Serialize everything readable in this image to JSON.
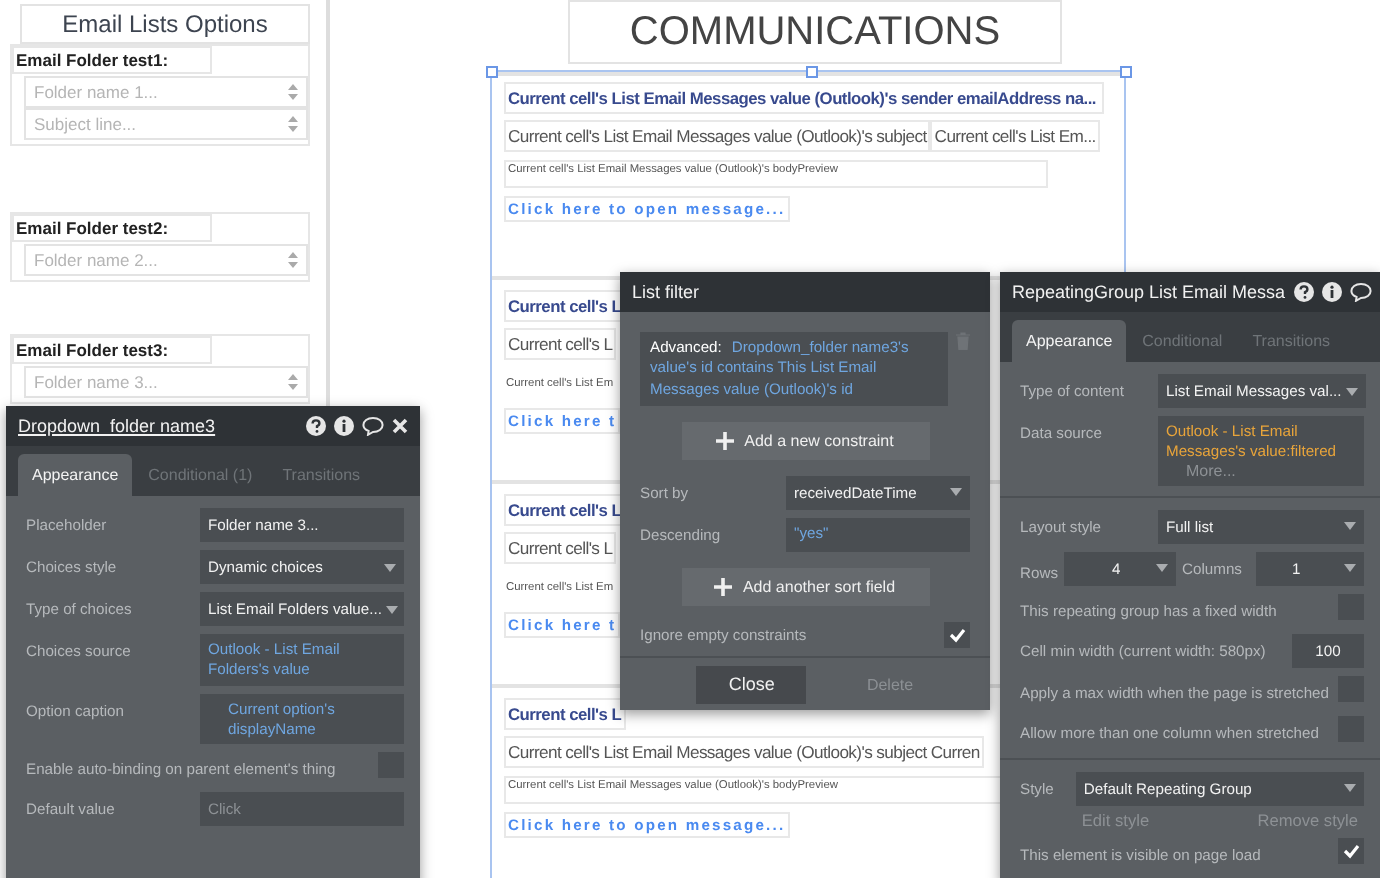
{
  "left_panel": {
    "title": "Email Lists Options",
    "groups": [
      {
        "label": "Email Folder test1:",
        "dropdowns": [
          {
            "placeholder": "Folder name 1..."
          },
          {
            "placeholder": "Subject line..."
          }
        ]
      },
      {
        "label": "Email Folder test2:",
        "dropdowns": [
          {
            "placeholder": "Folder name 2..."
          }
        ]
      },
      {
        "label": "Email Folder test3:",
        "dropdowns": [
          {
            "placeholder": "Folder name 3..."
          }
        ]
      }
    ]
  },
  "canvas": {
    "heading": "COMMUNICATIONS",
    "cells": [
      {
        "sender": "Current cell's List Email Messages value (Outlook)'s sender emailAddress na...",
        "subject": "Current cell's List Email Messages value (Outlook)'s subject",
        "subject_2": "Current cell's List Em...",
        "body_preview": "Current cell's List Email Messages value (Outlook)'s bodyPreview",
        "link": "Click here to open message..."
      },
      {
        "sender": "Current cell's L",
        "subject": "Current cell's L",
        "body_preview": "Current cell's List Em",
        "link": "Click here t"
      },
      {
        "sender": "Current cell's L",
        "subject": "Current cell's L",
        "body_preview": "Current cell's List Em",
        "link": "Click here t"
      },
      {
        "sender": "Current cell's L",
        "subject": "Current cell's List Email Messages value (Outlook)'s subject Curren",
        "body_preview": "Current cell's List Email Messages value (Outlook)'s bodyPreview",
        "link": "Click here to open message..."
      }
    ]
  },
  "property_panel": {
    "title": "Dropdown_folder name3",
    "tabs": [
      {
        "label": "Appearance",
        "selected": true
      },
      {
        "label": "Conditional (1)",
        "selected": false
      },
      {
        "label": "Transitions",
        "selected": false
      }
    ],
    "sections": [
      [
        {
          "kind": "input",
          "label": "Placeholder",
          "value": "Folder name 3..."
        },
        {
          "kind": "select",
          "label": "Choices style",
          "value": "Dynamic choices"
        },
        {
          "kind": "select",
          "label": "Type of choices",
          "value": "List Email Folders value..."
        },
        {
          "kind": "expression",
          "label": "Choices source",
          "value": "Outlook - List Email Folders's value"
        },
        {
          "kind": "expression",
          "label": "Option caption",
          "value": "Current option's displayName"
        },
        {
          "kind": "checkbox",
          "label": "Enable auto-binding on parent element's thing",
          "checked": false
        },
        {
          "kind": "input",
          "label": "Default value",
          "placeholder": "Click"
        }
      ]
    ]
  },
  "list_filter": {
    "title": "List filter",
    "constraint": {
      "label": "Advanced:",
      "expression": "Dropdown_folder name3's value's id contains This List Email Messages value (Outlook)'s id"
    },
    "add_constraint": "Add a new constraint",
    "rows": [
      {
        "kind": "select",
        "label": "Sort by",
        "value": "receivedDateTime"
      },
      {
        "kind": "expression",
        "label": "Descending",
        "value": "\"yes\""
      }
    ],
    "add_sort": "Add another sort field",
    "ignore_empty": {
      "label": "Ignore empty constraints",
      "checked": true
    },
    "buttons": [
      {
        "label": "Close",
        "disabled": false
      },
      {
        "label": "Delete",
        "disabled": true
      }
    ]
  },
  "repeating_group_panel": {
    "title": "RepeatingGroup List Email Messa",
    "tabs": [
      {
        "label": "Appearance",
        "selected": true
      },
      {
        "label": "Conditional",
        "selected": false
      },
      {
        "label": "Transitions",
        "selected": false
      }
    ],
    "sections": [
      [
        {
          "kind": "select",
          "label": "Type of content",
          "value": "List Email Messages val..."
        },
        {
          "kind": "data_source",
          "label": "Data source",
          "value": "Outlook - List Email Messages's value:filtered",
          "more": "More..."
        }
      ],
      [
        {
          "kind": "select",
          "label": "Layout style",
          "value": "Full list"
        },
        {
          "kind": "rows_columns",
          "label": "Rows",
          "value": "4",
          "label_2": "Columns",
          "value_2": "1"
        },
        {
          "kind": "checkbox",
          "label": "This repeating group has a fixed width",
          "checked": false
        },
        {
          "kind": "number",
          "label": "Cell min width (current width: 580px)",
          "value": "100"
        },
        {
          "kind": "checkbox",
          "label": "Apply a max width when the page is stretched",
          "checked": false
        },
        {
          "kind": "checkbox",
          "label": "Allow more than one column when stretched",
          "checked": false
        }
      ],
      [
        {
          "kind": "style",
          "label": "Style",
          "value": "Default Repeating Group",
          "edit": "Edit style",
          "remove": "Remove style"
        },
        {
          "kind": "checkbox",
          "label": "This element is visible on page load",
          "checked": true
        }
      ]
    ]
  }
}
